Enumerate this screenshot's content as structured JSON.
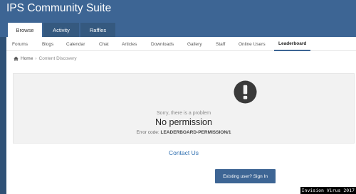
{
  "site": {
    "title": "IPS Community Suite"
  },
  "tabs": [
    {
      "label": "Browse",
      "active": true
    },
    {
      "label": "Activity",
      "active": false
    },
    {
      "label": "Raffles",
      "active": false
    }
  ],
  "subnav": [
    {
      "label": "Forums",
      "active": false
    },
    {
      "label": "Blogs",
      "active": false
    },
    {
      "label": "Calendar",
      "active": false
    },
    {
      "label": "Chat",
      "active": false
    },
    {
      "label": "Articles",
      "active": false
    },
    {
      "label": "Downloads",
      "active": false
    },
    {
      "label": "Gallery",
      "active": false
    },
    {
      "label": "Staff",
      "active": false
    },
    {
      "label": "Online Users",
      "active": false
    },
    {
      "label": "Leaderboard",
      "active": true
    }
  ],
  "breadcrumb": {
    "home": "Home",
    "current": "Content Discovery"
  },
  "error": {
    "icon": "exclamation-circle-icon",
    "subtitle": "Sorry, there is a problem",
    "title": "No permission",
    "code_label": "Error code:",
    "code_value": "LEADERBOARD-PERMISSION/1"
  },
  "contact": {
    "label": "Contact Us"
  },
  "signin": {
    "label": "Existing user? Sign In"
  },
  "watermark": {
    "text": "Invision Virus 2017"
  },
  "colors": {
    "header": "#3d6594",
    "link": "#2f6fb0",
    "error_bg": "#f2f2f2"
  }
}
